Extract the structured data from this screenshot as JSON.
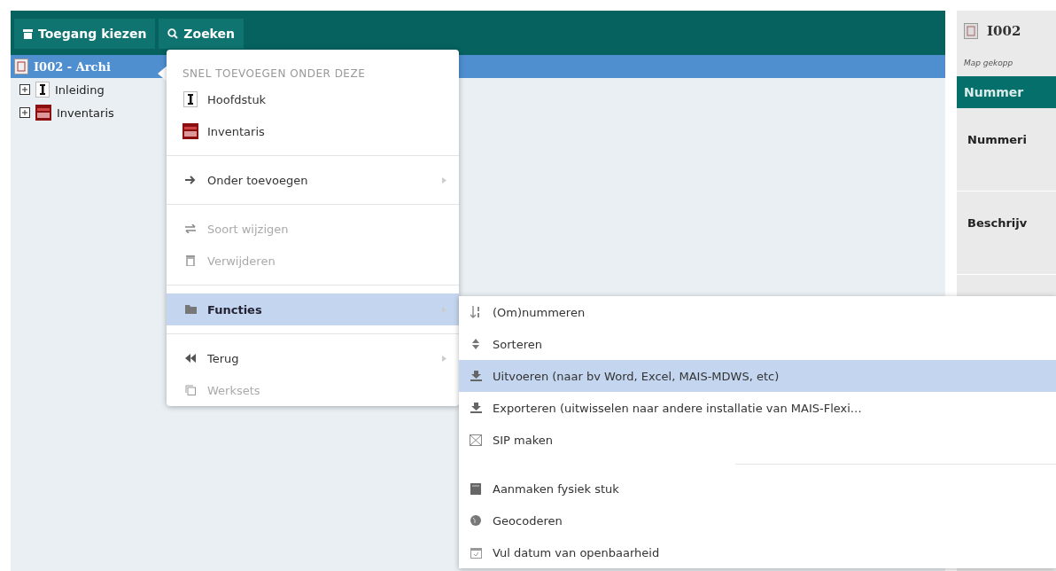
{
  "toolbar": {
    "buttons": [
      {
        "label": "Toegang kiezen"
      },
      {
        "label": "Zoeken"
      }
    ]
  },
  "tree": {
    "root": {
      "label": "I002 - Archi",
      "selected": true
    },
    "children": [
      {
        "label": "Inleiding",
        "kind": "chapter",
        "expanded": false
      },
      {
        "label": "Inventaris",
        "kind": "inventory",
        "expanded": false
      }
    ]
  },
  "context_menu": {
    "header": "SNEL TOEVOEGEN ONDER DEZE",
    "groups": [
      [
        {
          "label": "Hoofdstuk",
          "kind": "chapter",
          "disabled": false,
          "selected": false,
          "submenu": false
        },
        {
          "label": "Inventaris",
          "kind": "inventory",
          "disabled": false,
          "selected": false,
          "submenu": false
        }
      ],
      [
        {
          "label": "Onder toevoegen",
          "kind": "arrow",
          "disabled": false,
          "selected": false,
          "submenu": true
        }
      ],
      [
        {
          "label": "Soort wijzigen",
          "kind": "swap",
          "disabled": true,
          "selected": false,
          "submenu": false
        },
        {
          "label": "Verwijderen",
          "kind": "trash",
          "disabled": true,
          "selected": false,
          "submenu": false
        }
      ],
      [
        {
          "label": "Functies",
          "kind": "folder",
          "disabled": false,
          "selected": true,
          "submenu": true
        }
      ],
      [
        {
          "label": "Terug",
          "kind": "rewind",
          "disabled": false,
          "selected": false,
          "submenu": true
        },
        {
          "label": "Werksets",
          "kind": "copy",
          "disabled": true,
          "selected": false,
          "submenu": false
        }
      ]
    ]
  },
  "submenu": {
    "groups": [
      [
        {
          "label": "(Om)nummeren",
          "kind": "sortnum",
          "selected": false
        },
        {
          "label": "Sorteren",
          "kind": "sort",
          "selected": false
        },
        {
          "label": "Uitvoeren (naar bv Word, Excel, MAIS-MDWS, etc)",
          "kind": "download",
          "selected": true
        },
        {
          "label": "Exporteren (uitwisselen naar andere installatie van MAIS-Flexi…",
          "kind": "download",
          "selected": false
        },
        {
          "label": "SIP maken",
          "kind": "package",
          "selected": false
        }
      ],
      [
        {
          "label": "Aanmaken fysiek stuk",
          "kind": "book",
          "selected": false
        },
        {
          "label": "Geocoderen",
          "kind": "globe",
          "selected": false
        },
        {
          "label": "Vul datum van openbaarheid",
          "kind": "calendar",
          "selected": false
        }
      ]
    ]
  },
  "detail_panel": {
    "title": "I002",
    "note": "Map gekopp",
    "header": "Nummer",
    "fields": [
      "Nummeri",
      "Beschrijv"
    ]
  }
}
